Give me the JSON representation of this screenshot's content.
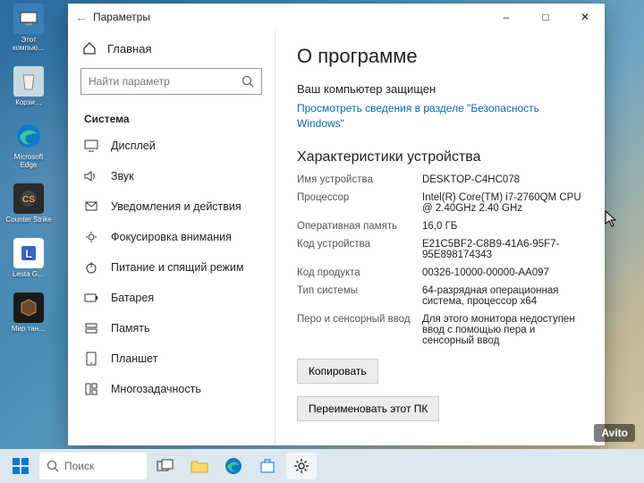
{
  "window": {
    "title": "Параметры",
    "minimize": "–",
    "maximize": "□",
    "close": "✕"
  },
  "sidebar": {
    "home_label": "Главная",
    "search_placeholder": "Найти параметр",
    "section": "Система",
    "items": [
      {
        "label": "Дисплей",
        "icon": "display-icon"
      },
      {
        "label": "Звук",
        "icon": "sound-icon"
      },
      {
        "label": "Уведомления и действия",
        "icon": "notifications-icon"
      },
      {
        "label": "Фокусировка внимания",
        "icon": "focus-icon"
      },
      {
        "label": "Питание и спящий режим",
        "icon": "power-icon"
      },
      {
        "label": "Батарея",
        "icon": "battery-icon"
      },
      {
        "label": "Память",
        "icon": "storage-icon"
      },
      {
        "label": "Планшет",
        "icon": "tablet-icon"
      },
      {
        "label": "Многозадачность",
        "icon": "multitask-icon"
      }
    ]
  },
  "content": {
    "heading": "О программе",
    "protected_label": "Ваш компьютер защищен",
    "security_link": "Просмотреть сведения в разделе \"Безопасность Windows\"",
    "specs_heading": "Характеристики устройства",
    "specs": {
      "device_name_k": "Имя устройства",
      "device_name_v": "DESKTOP-C4HC078",
      "cpu_k": "Процессор",
      "cpu_v": "Intel(R) Core(TM) i7-2760QM CPU @ 2.40GHz   2.40 GHz",
      "ram_k": "Оперативная память",
      "ram_v": "16,0 ГБ",
      "device_id_k": "Код устройства",
      "device_id_v": "E21C5BF2-C8B9-41A6-95F7-95E898174343",
      "product_id_k": "Код продукта",
      "product_id_v": "00326-10000-00000-AA097",
      "system_type_k": "Тип системы",
      "system_type_v": "64-разрядная операционная система, процессор x64",
      "pen_touch_k": "Перо и сенсорный ввод",
      "pen_touch_v": "Для этого монитора недоступен ввод с помощью пера и сенсорный ввод"
    },
    "copy_btn": "Копировать",
    "rename_btn": "Переименовать этот ПК"
  },
  "desktop_icons": [
    {
      "label": "Этот компью…"
    },
    {
      "label": "Корзи…"
    },
    {
      "label": "Microsoft Edge"
    },
    {
      "label": "Counter Strike"
    },
    {
      "label": "Lesta G…"
    },
    {
      "label": "Мир тан…"
    }
  ],
  "taskbar": {
    "search": "Поиск"
  },
  "watermark": "Avito"
}
